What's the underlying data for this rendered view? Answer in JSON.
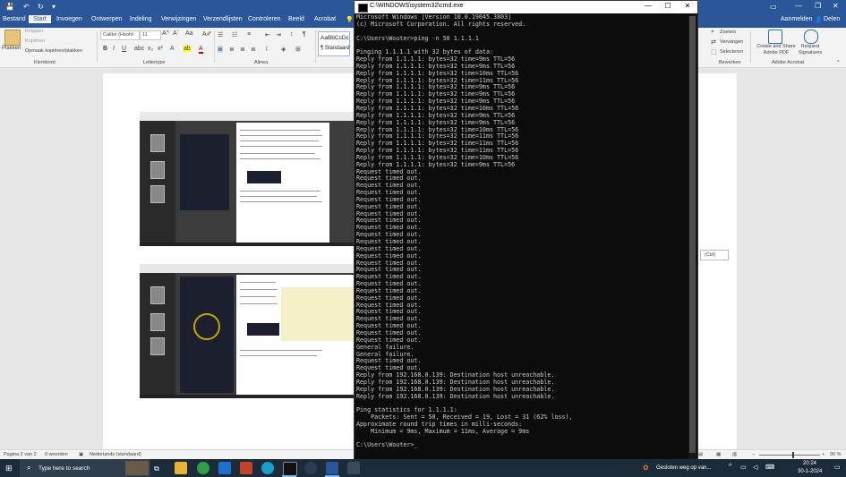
{
  "word": {
    "tabs": [
      "Bestand",
      "Start",
      "Invoegen",
      "Ontwerpen",
      "Indeling",
      "Verwijzingen",
      "Verzendlijsten",
      "Controleren",
      "Beeld",
      "Acrobat"
    ],
    "user_name": "Aanmelden",
    "share_label": "Delen",
    "clipboard": {
      "paste": "Plakken",
      "cut": "Knippen",
      "copy": "Kopiëren",
      "format_painter": "Opmaak kopiëren/plakken",
      "group": "Klembord"
    },
    "font": {
      "name": "Calibri (Hoofd",
      "size": "11",
      "group": "Lettertype"
    },
    "paragraph_group": "Alinea",
    "styles": {
      "sample": "AaBbCcDc",
      "name": "¶ Standaard"
    },
    "editing": {
      "find": "Zoeken",
      "replace": "Vervangen",
      "select": "Selecteren",
      "group": "Bewerken"
    },
    "acrobat": {
      "create_share": "Create and Share Adobe PDF",
      "request_signatures": "Request Signatures",
      "group": "Adobe Acrobat"
    },
    "paste_options": "(Ctrl)",
    "status": {
      "page": "Pagina 2 van 2",
      "words": "0 woorden",
      "language": "Nederlands (standaard)",
      "zoom": "90 %"
    }
  },
  "cmd": {
    "title": "C:\\WINDOWS\\system32\\cmd.exe",
    "lines": [
      "Microsoft Windows [Version 10.0.19045.3803]",
      "(c) Microsoft Corporation. All rights reserved.",
      "",
      "C:\\Users\\Wouter>ping -n 50 1.1.1.1",
      "",
      "Pinging 1.1.1.1 with 32 bytes of data:",
      "Reply from 1.1.1.1: bytes=32 time=9ms TTL=56",
      "Reply from 1.1.1.1: bytes=32 time=9ms TTL=56",
      "Reply from 1.1.1.1: bytes=32 time=10ms TTL=56",
      "Reply from 1.1.1.1: bytes=32 time=11ms TTL=56",
      "Reply from 1.1.1.1: bytes=32 time=9ms TTL=56",
      "Reply from 1.1.1.1: bytes=32 time=9ms TTL=56",
      "Reply from 1.1.1.1: bytes=32 time=9ms TTL=56",
      "Reply from 1.1.1.1: bytes=32 time=10ms TTL=56",
      "Reply from 1.1.1.1: bytes=32 time=9ms TTL=56",
      "Reply from 1.1.1.1: bytes=32 time=9ms TTL=56",
      "Reply from 1.1.1.1: bytes=32 time=10ms TTL=56",
      "Reply from 1.1.1.1: bytes=32 time=11ms TTL=56",
      "Reply from 1.1.1.1: bytes=32 time=11ms TTL=56",
      "Reply from 1.1.1.1: bytes=32 time=11ms TTL=56",
      "Reply from 1.1.1.1: bytes=32 time=10ms TTL=56",
      "Reply from 1.1.1.1: bytes=32 time=9ms TTL=56",
      "Request timed out.",
      "Request timed out.",
      "Request timed out.",
      "Request timed out.",
      "Request timed out.",
      "Request timed out.",
      "Request timed out.",
      "Request timed out.",
      "Request timed out.",
      "Request timed out.",
      "Request timed out.",
      "Request timed out.",
      "Request timed out.",
      "Request timed out.",
      "Request timed out.",
      "Request timed out.",
      "Request timed out.",
      "Request timed out.",
      "Request timed out.",
      "Request timed out.",
      "Request timed out.",
      "Request timed out.",
      "Request timed out.",
      "Request timed out.",
      "Request timed out.",
      "General failure.",
      "General failure.",
      "Request timed out.",
      "Request timed out.",
      "Reply from 192.168.0.139: Destination host unreachable.",
      "Reply from 192.168.0.139: Destination host unreachable.",
      "Reply from 192.168.0.139: Destination host unreachable.",
      "Reply from 192.168.0.139: Destination host unreachable.",
      "",
      "Ping statistics for 1.1.1.1:",
      "    Packets: Sent = 50, Received = 19, Lost = 31 (62% loss),",
      "Approximate round trip times in milli-seconds:",
      "    Minimum = 9ms, Maximum = 11ms, Average = 9ms",
      "",
      "C:\\Users\\Wouter>"
    ]
  },
  "taskbar": {
    "search_placeholder": "Type here to search",
    "notification": "Gesloten weg op van...",
    "time": "20:24",
    "date": "30-1-2024"
  }
}
